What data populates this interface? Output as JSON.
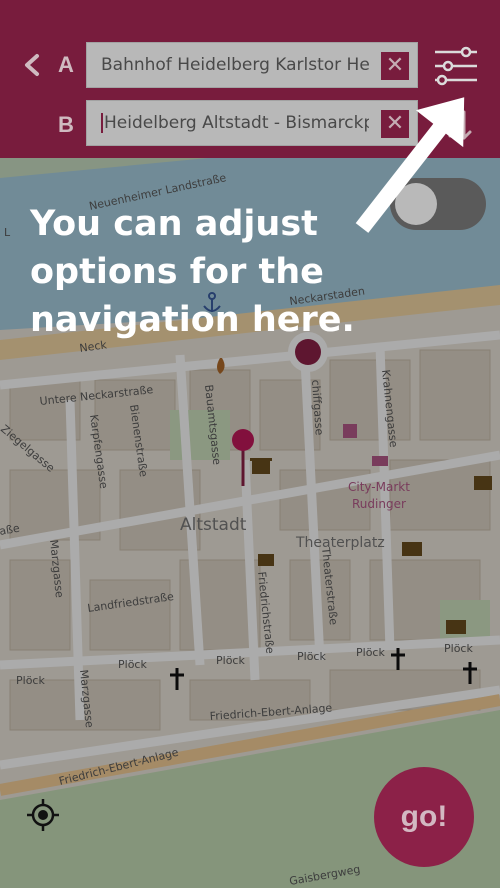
{
  "header": {
    "back_icon": "chevron-left-icon",
    "label_a": "A",
    "label_b": "B",
    "from_value": "Bahnhof Heidelberg Karlstor He",
    "to_value": "Heidelberg Altstadt - Bismarckpla",
    "clear_symbol": "✕",
    "options_icon": "sliders-icon",
    "swap_icon": "swap-vertical-icon",
    "brand_color": "#8c2148"
  },
  "tooltip": {
    "text": "You can adjust options for the navigation here."
  },
  "go_button": {
    "label": "go!"
  },
  "map": {
    "streets": {
      "neuenheimer": "Neuenheimer Landstraße",
      "neckarstaden": "Neckarstaden",
      "neckar_short": "Neck",
      "untere_neckar": "Untere Neckarstraße",
      "karpfengasse": "Karpfengasse",
      "bienenstrasse": "Bienenstraße",
      "bauamtsgasse": "Bauamtsgasse",
      "schiffgasse": "chiffgasse",
      "krahnengasse": "Krahnengasse",
      "ziegelgasse": "Ziegelgasse",
      "marzgasse": "Marzgasse",
      "marzgasse2": "Marzgasse",
      "landfriedstrasse": "Landfriedstraße",
      "friedrichstrasse": "Friedrichstraße",
      "theaterstrasse": "Theaterstraße",
      "plock1": "Plöck",
      "plock2": "Plöck",
      "plock3": "Plöck",
      "plock4": "Plöck",
      "plock5": "Plöck",
      "plock6": "Plöck",
      "plock7": "Plöck",
      "ebert1": "Friedrich-Ebert-Anlage",
      "ebert2": "Friedrich-Ebert-Anlage",
      "strasse_frag": "aße",
      "weg_frag": "Gaisbergweg",
      "l_frag": "L"
    },
    "places": {
      "altstadt": "Altstadt",
      "theaterplatz": "Theaterplatz",
      "city_markt": "City-Markt",
      "rudinger": "Rudinger"
    },
    "icons": {
      "museum": "museum-icon",
      "church": "church-icon",
      "shop": "shopping-cart-icon",
      "library": "library-icon",
      "anchor": "anchor-icon",
      "fire": "fire-icon",
      "theatre": "theatre-icon",
      "gift": "gift-icon"
    }
  },
  "locate_icon": "crosshair-icon"
}
